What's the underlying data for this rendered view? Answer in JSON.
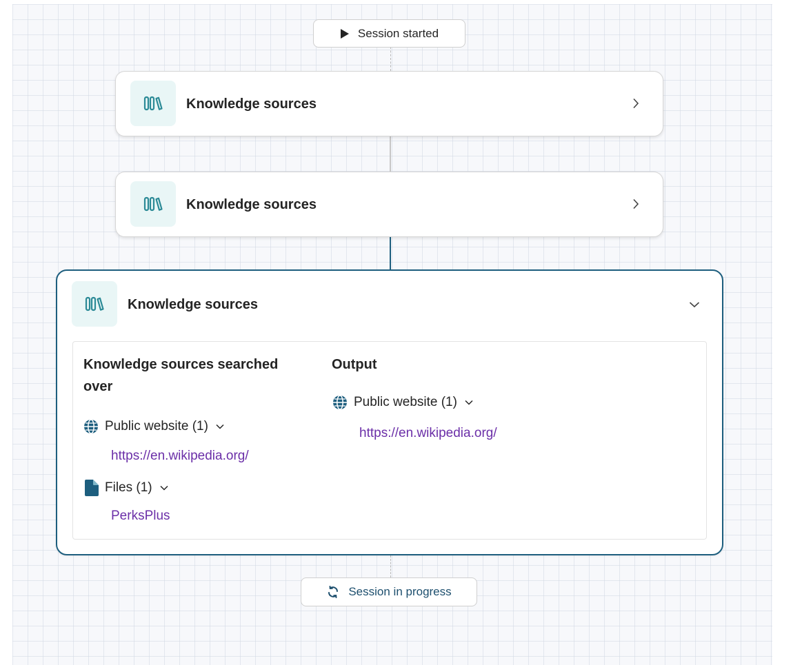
{
  "flow": {
    "start_label": "Session started",
    "end_label": "Session in progress",
    "nodes": [
      {
        "title": "Knowledge sources"
      },
      {
        "title": "Knowledge sources"
      },
      {
        "title": "Knowledge sources"
      }
    ],
    "details": {
      "searched_heading": "Knowledge sources searched over",
      "output_heading": "Output",
      "searched": {
        "website_label": "Public website (1)",
        "website_url": "https://en.wikipedia.org/",
        "files_label": "Files (1)",
        "file_name": "PerksPlus"
      },
      "output": {
        "website_label": "Public website (1)",
        "website_url": "https://en.wikipedia.org/"
      }
    }
  },
  "colors": {
    "accent": "#1d5e7e",
    "link": "#6b2fa8",
    "icon_teal": "#2b8a96",
    "icon_bg": "#e9f6f6"
  },
  "icons": {
    "start": "play-icon",
    "node": "library-books-icon",
    "collapsed": "chevron-right-icon",
    "expanded": "chevron-down-icon",
    "website": "globe-icon",
    "files": "document-icon",
    "progress": "refresh-icon"
  }
}
